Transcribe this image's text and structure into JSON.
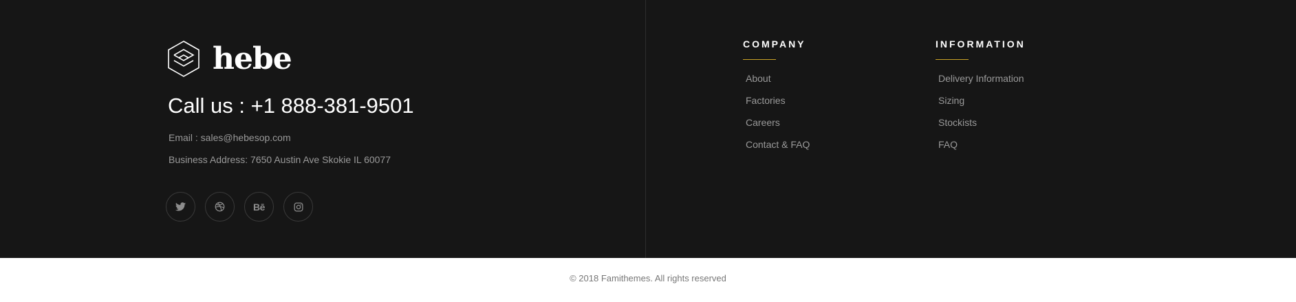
{
  "brand": {
    "name": "hebe",
    "logo_icon": "hexagon-logo-icon"
  },
  "contact": {
    "call": "Call us : +1 888-381-9501",
    "email": "Email : sales@hebesop.com",
    "address": "Business Address: 7650 Austin Ave Skokie IL 60077"
  },
  "socials": [
    {
      "icon": "twitter-icon"
    },
    {
      "icon": "dribbble-icon"
    },
    {
      "icon": "behance-icon",
      "glyph": "Bē"
    },
    {
      "icon": "instagram-icon"
    }
  ],
  "company": {
    "title": "COMPANY",
    "links": [
      "About",
      "Factories",
      "Careers",
      "Contact & FAQ"
    ]
  },
  "information": {
    "title": "INFORMATION",
    "links": [
      "Delivery Information",
      "Sizing",
      "Stockists",
      "FAQ"
    ]
  },
  "copyright": "© 2018 Famithemes. All rights reserved",
  "colors": {
    "footer_bg": "#161616",
    "accent": "#c9a227",
    "muted_text": "#9a9a9a",
    "bottom_bar_bg": "#ffffff"
  }
}
